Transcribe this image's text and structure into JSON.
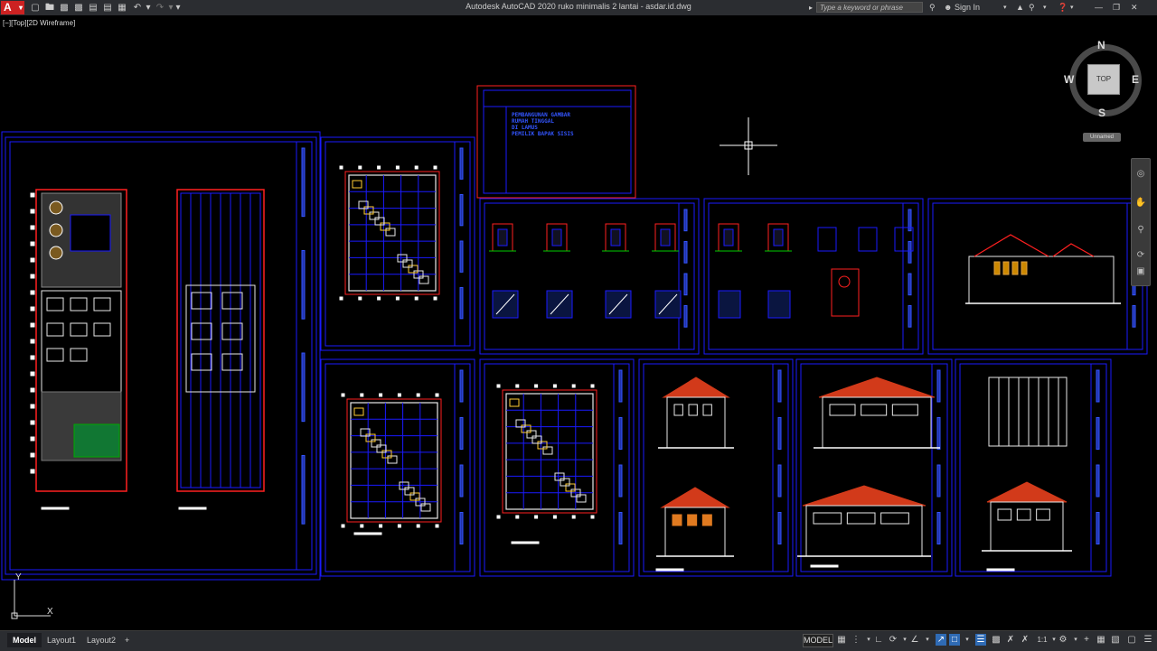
{
  "app": {
    "window_title": "Autodesk AutoCAD 2020    ruko minimalis 2 lantai - asdar.id.dwg",
    "logo_letter": "A",
    "search_placeholder": "Type a keyword or phrase",
    "sign_in": "Sign In"
  },
  "viewport": {
    "label": "[−][Top][2D Wireframe]"
  },
  "viewcube": {
    "top": "TOP",
    "n": "N",
    "s": "S",
    "e": "E",
    "w": "W",
    "ucs_name": "Unnamed"
  },
  "ucs": {
    "y": "Y",
    "x": "X"
  },
  "title_block": {
    "lines": [
      "PEMBANGUNAN GAMBAR",
      "RUMAH TINGGAL",
      "DI LAMUS",
      "PEMILIK BAPAK SISIS"
    ]
  },
  "layout_tabs": [
    {
      "label": "Model",
      "active": true
    },
    {
      "label": "Layout1",
      "active": false
    },
    {
      "label": "Layout2",
      "active": false
    }
  ],
  "add_tab": "+",
  "status": {
    "model": "MODEL",
    "scale": "1:1"
  },
  "colors": {
    "frame_blue": "#1a1aff",
    "frame_red": "#ff2020",
    "text_blue": "#3355ff",
    "wall_white": "#e8e8e8",
    "roof_red": "#d23a1a",
    "facade_orange": "#e07a20",
    "status_on": "#2f6bb5"
  },
  "icons": {
    "quick_access": [
      "new-icon",
      "open-icon",
      "save-icon",
      "save-as-icon",
      "print-icon",
      "plot-icon",
      "undo-icon",
      "redo-icon",
      "customize-icon"
    ],
    "right": [
      "search-icon",
      "user-icon",
      "exchange-icon",
      "help-icon",
      "minimize-icon",
      "maximize-icon",
      "close-icon"
    ],
    "status": [
      "grid-icon",
      "snap-icon",
      "ortho-icon",
      "polar-icon",
      "isodraft-icon",
      "osnap-icon",
      "lineweight-icon",
      "transparency-icon",
      "annotation-icon",
      "workspace-icon",
      "customization-icon"
    ]
  }
}
